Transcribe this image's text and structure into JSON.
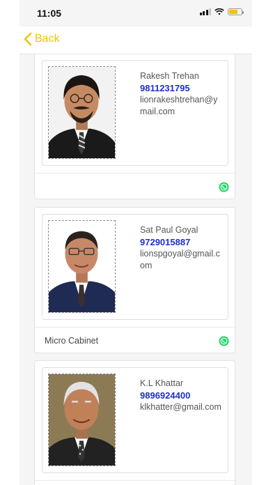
{
  "status_bar": {
    "time": "11:05"
  },
  "nav": {
    "back_label": "Back"
  },
  "members": [
    {
      "name": "Rakesh Trehan",
      "phone": "9811231795",
      "email": "lionrakeshtrehan@ymail.com",
      "designation": ""
    },
    {
      "name": "Sat Paul Goyal",
      "phone": "9729015887",
      "email": "lionspgoyal@gmail.com",
      "designation": "Micro Cabinet"
    },
    {
      "name": "K.L Khattar",
      "phone": "9896924400",
      "email": "klkhatter@gmail.com",
      "designation": ""
    }
  ],
  "colors": {
    "accent": "#f2c200",
    "phone": "#1e2fc8",
    "whatsapp": "#25d366"
  },
  "icons": {
    "back": "chevron-left-icon",
    "contact_action": "whatsapp-icon"
  }
}
